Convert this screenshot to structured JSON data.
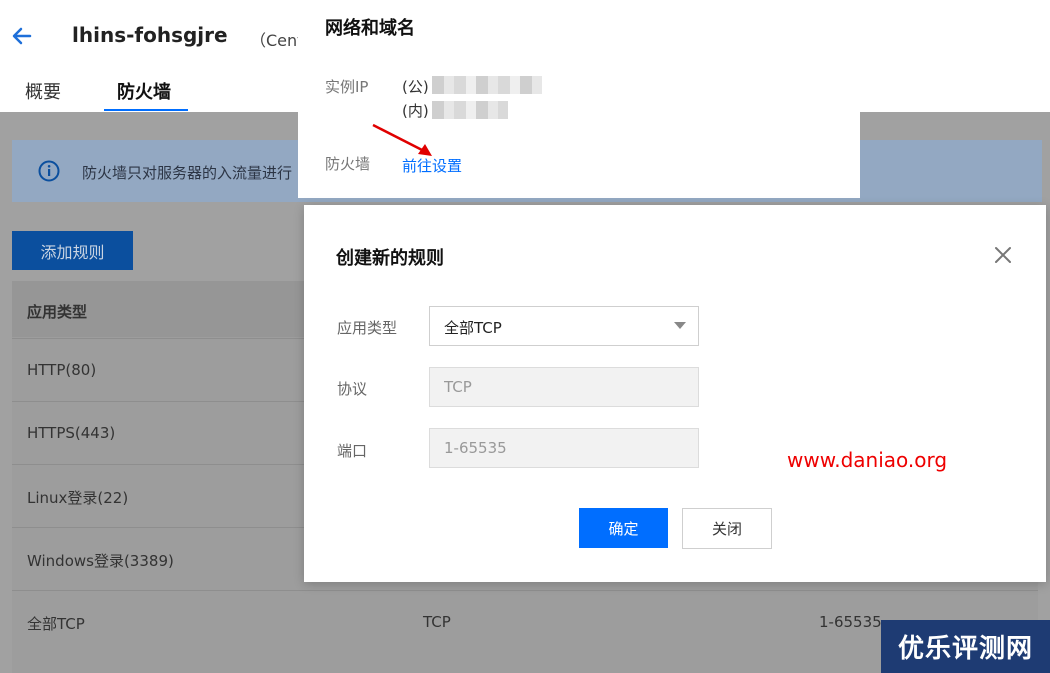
{
  "header": {
    "instance_name": "lhins-fohsgjre",
    "instance_os": "（CentO"
  },
  "tabs": [
    {
      "label": "概要"
    },
    {
      "label": "防火墙"
    }
  ],
  "notice": {
    "text": "防火墙只对服务器的入流量进行"
  },
  "toolbar": {
    "add_rule_label": "添加规则"
  },
  "table": {
    "headers": [
      "应用类型"
    ],
    "rows": [
      {
        "app": "HTTP(80)",
        "protocol": "",
        "port": ""
      },
      {
        "app": "HTTPS(443)",
        "protocol": "",
        "port": ""
      },
      {
        "app": "Linux登录(22)",
        "protocol": "",
        "port": ""
      },
      {
        "app": "Windows登录(3389)",
        "protocol": "",
        "port": ""
      },
      {
        "app": "全部TCP",
        "protocol": "TCP",
        "port": "1-65535"
      }
    ]
  },
  "info_popup": {
    "title": "网络和域名",
    "ip_label": "实例IP",
    "public_prefix": "(公)",
    "private_prefix": "(内)",
    "firewall_label": "防火墙",
    "firewall_link": "前往设置",
    "annotation_color": "#e00000"
  },
  "dialog": {
    "title": "创建新的规则",
    "fields": {
      "app_type_label": "应用类型",
      "app_type_value": "全部TCP",
      "protocol_label": "协议",
      "protocol_value": "TCP",
      "port_label": "端口",
      "port_value": "1-65535"
    },
    "confirm_label": "确定",
    "close_label": "关闭"
  },
  "watermarks": {
    "url": "www.daniao.org",
    "logo": "优乐评测网"
  },
  "colors": {
    "primary": "#006eff",
    "overlay": "#a1a1a1",
    "annotation": "#e00000"
  }
}
